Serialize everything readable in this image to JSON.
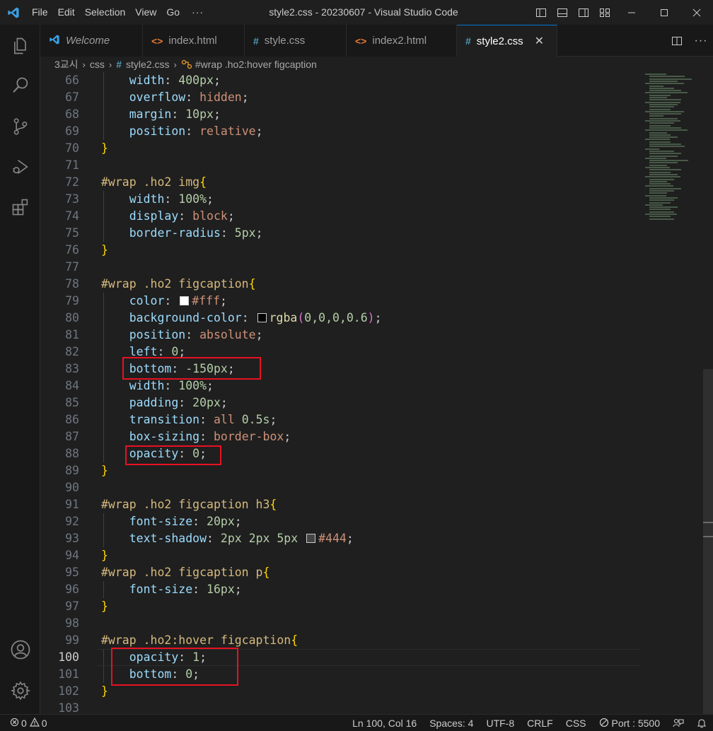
{
  "window": {
    "title": "style2.css - 20230607 - Visual Studio Code",
    "menu": [
      "File",
      "Edit",
      "Selection",
      "View",
      "Go"
    ],
    "menu_more": "···"
  },
  "tabs": [
    {
      "label": "Welcome",
      "icon": "vscode-logo-icon",
      "active": false,
      "italic": true
    },
    {
      "label": "index.html",
      "icon": "html-file-icon",
      "active": false
    },
    {
      "label": "style.css",
      "icon": "css-file-icon",
      "active": false
    },
    {
      "label": "index2.html",
      "icon": "html-file-icon",
      "active": false
    },
    {
      "label": "style2.css",
      "icon": "css-file-icon",
      "active": true
    }
  ],
  "tab_close": "✕",
  "breadcrumbs": {
    "folder1": "3교시",
    "folder2": "css",
    "file": "style2.css",
    "symbol": "#wrap .ho2:hover figcaption"
  },
  "editor": {
    "current_line": 100,
    "lines": [
      {
        "n": "66"
      },
      {
        "n": "67"
      },
      {
        "n": "68"
      },
      {
        "n": "69"
      },
      {
        "n": "70"
      },
      {
        "n": "71"
      },
      {
        "n": "72"
      },
      {
        "n": "73"
      },
      {
        "n": "74"
      },
      {
        "n": "75"
      },
      {
        "n": "76"
      },
      {
        "n": "77"
      },
      {
        "n": "78"
      },
      {
        "n": "79"
      },
      {
        "n": "80"
      },
      {
        "n": "81"
      },
      {
        "n": "82"
      },
      {
        "n": "83"
      },
      {
        "n": "84"
      },
      {
        "n": "85"
      },
      {
        "n": "86"
      },
      {
        "n": "87"
      },
      {
        "n": "88"
      },
      {
        "n": "89"
      },
      {
        "n": "90"
      },
      {
        "n": "91"
      },
      {
        "n": "92"
      },
      {
        "n": "93"
      },
      {
        "n": "94"
      },
      {
        "n": "95"
      },
      {
        "n": "96"
      },
      {
        "n": "97"
      },
      {
        "n": "98"
      },
      {
        "n": "99"
      },
      {
        "n": "100"
      },
      {
        "n": "101"
      },
      {
        "n": "102"
      },
      {
        "n": "103"
      }
    ],
    "code": {
      "l66": {
        "prop": "width",
        "val": "400px"
      },
      "l67": {
        "prop": "overflow",
        "val": "hidden"
      },
      "l68": {
        "prop": "margin",
        "val": "10px"
      },
      "l69": {
        "prop": "position",
        "val": "relative"
      },
      "l72": {
        "sel": "#wrap .ho2",
        "tag": "img"
      },
      "l73": {
        "prop": "width",
        "val": "100%"
      },
      "l74": {
        "prop": "display",
        "val": "block"
      },
      "l75": {
        "prop": "border-radius",
        "val": "5px"
      },
      "l78": {
        "sel": "#wrap .ho2",
        "tag": "figcaption"
      },
      "l79": {
        "prop": "color",
        "val": "#fff",
        "swatch": "#ffffff"
      },
      "l80": {
        "prop": "background-color",
        "fn": "rgba",
        "args": "0,0,0,0.6",
        "swatch": "#000000"
      },
      "l81": {
        "prop": "position",
        "val": "absolute"
      },
      "l82": {
        "prop": "left",
        "val": "0"
      },
      "l83": {
        "prop": "bottom",
        "val": "-150px"
      },
      "l84": {
        "prop": "width",
        "val": "100%"
      },
      "l85": {
        "prop": "padding",
        "val": "20px"
      },
      "l86": {
        "prop": "transition",
        "val1": "all",
        "val2": "0.5s"
      },
      "l87": {
        "prop": "box-sizing",
        "val": "border-box"
      },
      "l88": {
        "prop": "opacity",
        "val": "0"
      },
      "l91": {
        "sel": "#wrap .ho2",
        "tag": "figcaption h3"
      },
      "l92": {
        "prop": "font-size",
        "val": "20px"
      },
      "l93": {
        "prop": "text-shadow",
        "val": "2px 2px 5px",
        "val2": "#444",
        "swatch": "#444444"
      },
      "l95": {
        "sel": "#wrap .ho2",
        "tag": "figcaption p"
      },
      "l96": {
        "prop": "font-size",
        "val": "16px"
      },
      "l99": {
        "sel": "#wrap .ho2:hover",
        "tag": "figcaption"
      },
      "l100": {
        "prop": "opacity",
        "val": "1"
      },
      "l101": {
        "prop": "bottom",
        "val": "0"
      }
    },
    "open_brace": "{",
    "close_brace": "}"
  },
  "statusbar": {
    "errors": "0",
    "warnings": "0",
    "position": "Ln 100, Col 16",
    "spaces": "Spaces: 4",
    "encoding": "UTF-8",
    "eol": "CRLF",
    "language": "CSS",
    "port": "Port : 5500"
  },
  "colors": {
    "accent": "#0078d4",
    "highlight_box": "#e81123",
    "html_icon": "#e37933",
    "css_icon": "#519aba"
  }
}
